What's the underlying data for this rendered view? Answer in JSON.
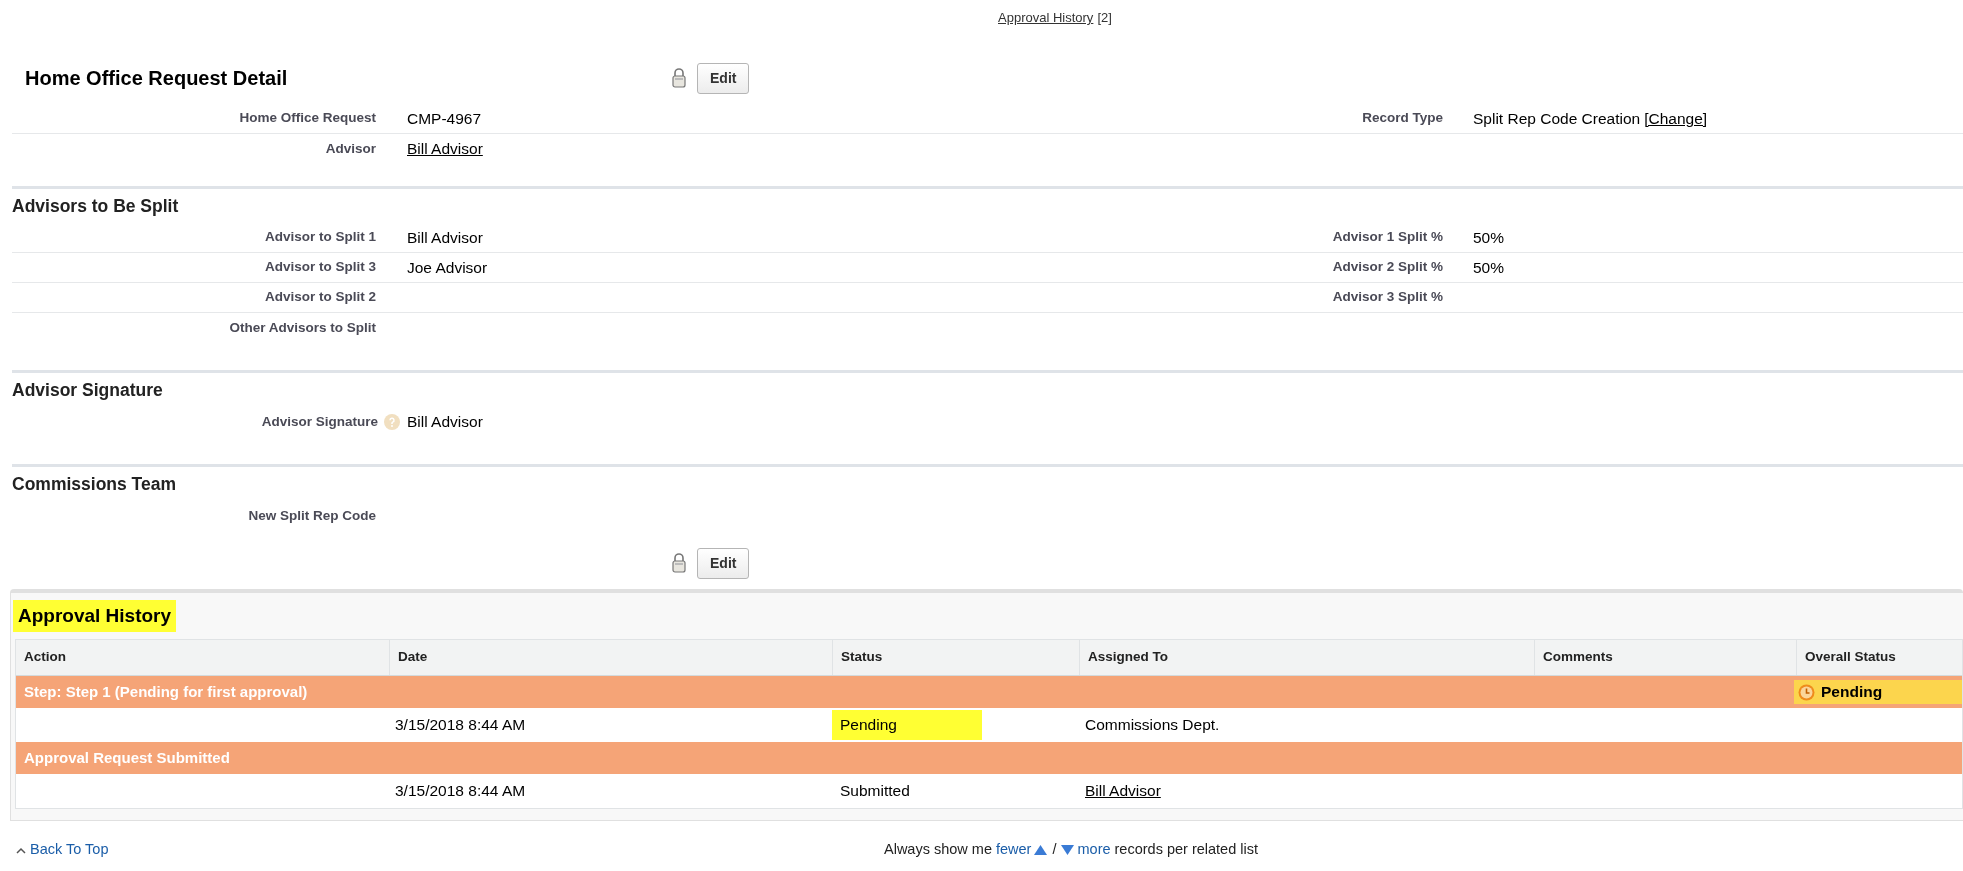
{
  "top_link": {
    "label": "Approval History",
    "count": "[2]"
  },
  "detail": {
    "title": "Home Office Request Detail",
    "button": "Edit",
    "locked": true,
    "rows": [
      {
        "left": {
          "label": "Home Office Request",
          "value": "CMP-4967"
        },
        "right": {
          "label": "Record Type",
          "value": "Split Rep Code Creation",
          "action": "[Change]"
        }
      },
      {
        "left": {
          "label": "Advisor",
          "value": "Bill Advisor",
          "link": true
        }
      }
    ]
  },
  "sections": [
    {
      "title": "Advisors to Be Split",
      "rows": [
        {
          "left": {
            "label": "Advisor to Split 1",
            "value": "Bill Advisor"
          },
          "right": {
            "label": "Advisor 1 Split %",
            "value": "50%"
          }
        },
        {
          "left": {
            "label": "Advisor to Split 3",
            "value": "Joe Advisor"
          },
          "right": {
            "label": "Advisor 2 Split %",
            "value": "50%"
          }
        },
        {
          "left": {
            "label": "Advisor to Split 2"
          },
          "right": {
            "label": "Advisor 3 Split %"
          }
        },
        {
          "left": {
            "label": "Other Advisors to Split"
          }
        }
      ]
    },
    {
      "title": "Advisor Signature",
      "rows": [
        {
          "left": {
            "label": "Advisor Signature",
            "value": "Bill Advisor",
            "help": true
          }
        }
      ]
    },
    {
      "title": "Commissions Team",
      "rows": [
        {
          "left": {
            "label": "New Split Rep Code"
          }
        }
      ]
    }
  ],
  "bottom_button": "Edit",
  "approval_history": {
    "title": "Approval History",
    "highlighted": true,
    "columns": [
      "Action",
      "Date",
      "Status",
      "Assigned To",
      "Comments",
      "Overall Status"
    ],
    "rows": [
      {
        "kind": "step",
        "text": "Step: Step 1 (Pending for first approval)",
        "overall_status": "Pending"
      },
      {
        "kind": "item",
        "date": "3/15/2018 8:44 AM",
        "status": "Pending",
        "status_highlighted": true,
        "assigned_to": "Commissions Dept.",
        "assigned_link": false
      },
      {
        "kind": "step",
        "text": "Approval Request Submitted"
      },
      {
        "kind": "item",
        "date": "3/15/2018 8:44 AM",
        "status": "Submitted",
        "status_highlighted": false,
        "assigned_to": "Bill Advisor",
        "assigned_link": true
      }
    ]
  },
  "footer": {
    "back_to_top": "Back To Top",
    "prefix": "Always show me",
    "fewer": "fewer",
    "separator": "/",
    "more": "more",
    "suffix": "records per related list"
  }
}
